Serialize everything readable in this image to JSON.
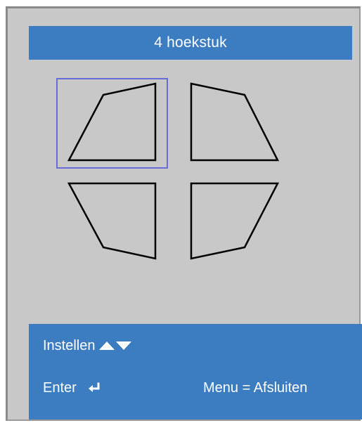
{
  "title": "4 hoekstuk",
  "corners": [
    {
      "name": "top-left",
      "selected": true
    },
    {
      "name": "top-right",
      "selected": false
    },
    {
      "name": "bottom-left",
      "selected": false
    },
    {
      "name": "bottom-right",
      "selected": false
    }
  ],
  "footer": {
    "adjust_label": "Instellen",
    "enter_label": "Enter",
    "menu_exit_label": "Menu = Afsluiten"
  },
  "icons": {
    "adjust": [
      "up-arrow-icon",
      "down-arrow-icon"
    ],
    "enter": "enter-return-icon"
  },
  "colors": {
    "background": "#c8c8c8",
    "bar": "#3b7dc0",
    "text": "#ffffff",
    "selection": "#6a6ad8"
  }
}
